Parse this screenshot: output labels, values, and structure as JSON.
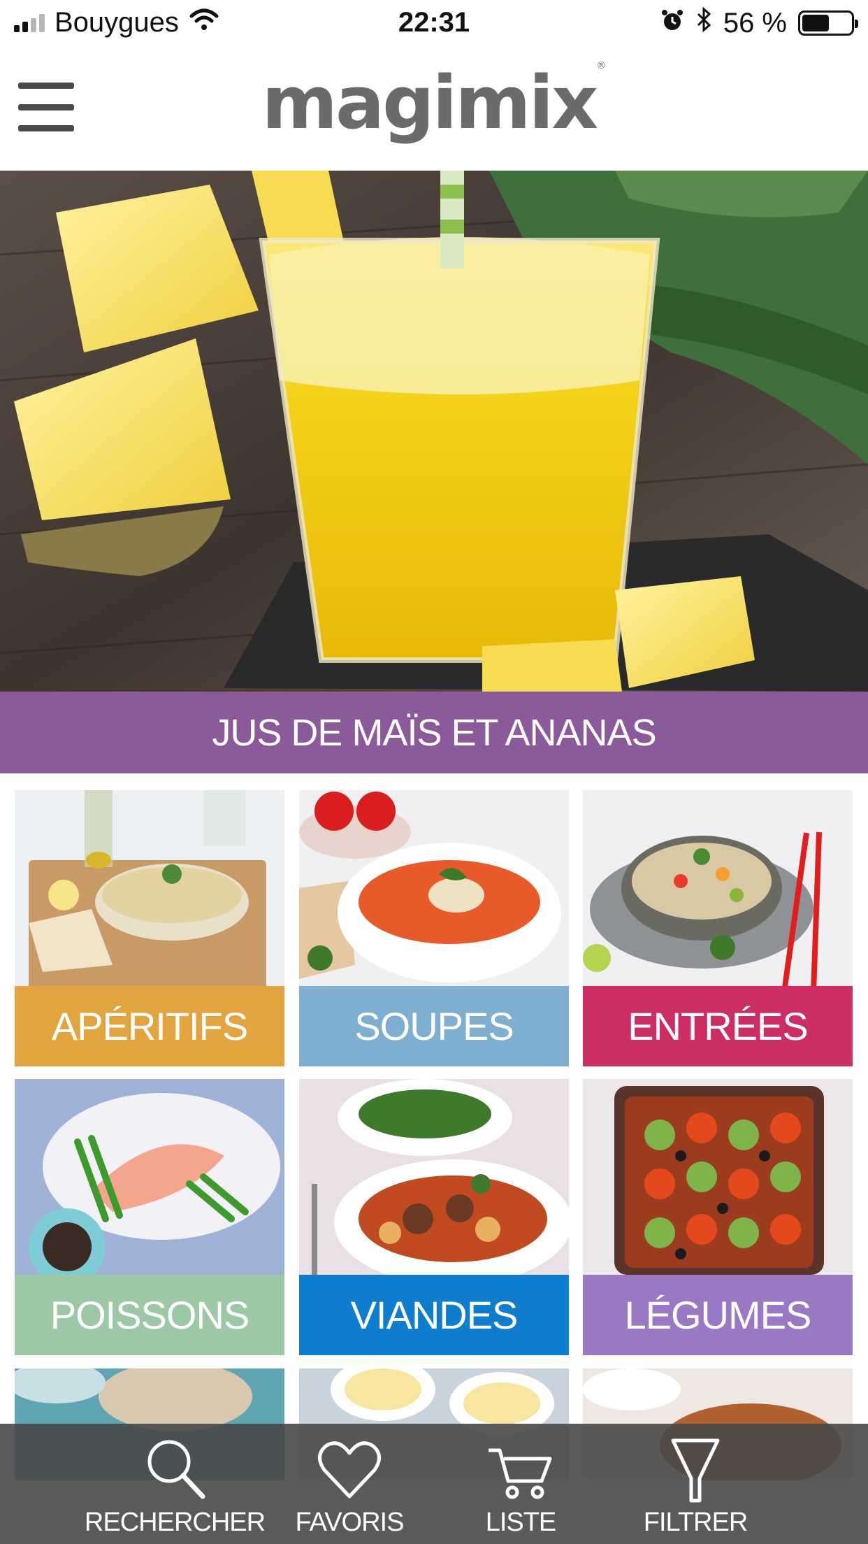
{
  "status_bar": {
    "carrier": "Bouygues",
    "time": "22:31",
    "battery_text": "56 %",
    "battery_level": 0.56
  },
  "header": {
    "logo_text": "magimix",
    "logo_mark": "®"
  },
  "hero": {
    "title": "JUS DE MAÏS ET ANANAS",
    "banner_color": "#8a5a9a"
  },
  "categories": [
    {
      "label": "APÉRITIFS",
      "color": "#e2a43e"
    },
    {
      "label": "SOUPES",
      "color": "#7eaed0"
    },
    {
      "label": "ENTRÉES",
      "color": "#cc2e64"
    },
    {
      "label": "POISSONS",
      "color": "#9cc8a6"
    },
    {
      "label": "VIANDES",
      "color": "#0e7dcd"
    },
    {
      "label": "LÉGUMES",
      "color": "#9a79c4"
    }
  ],
  "tabbar": {
    "items": [
      {
        "label": "RECHERCHER",
        "icon": "search-icon"
      },
      {
        "label": "FAVORIS",
        "icon": "heart-icon"
      },
      {
        "label": "LISTE",
        "icon": "cart-icon"
      },
      {
        "label": "FILTRER",
        "icon": "filter-icon"
      }
    ]
  }
}
